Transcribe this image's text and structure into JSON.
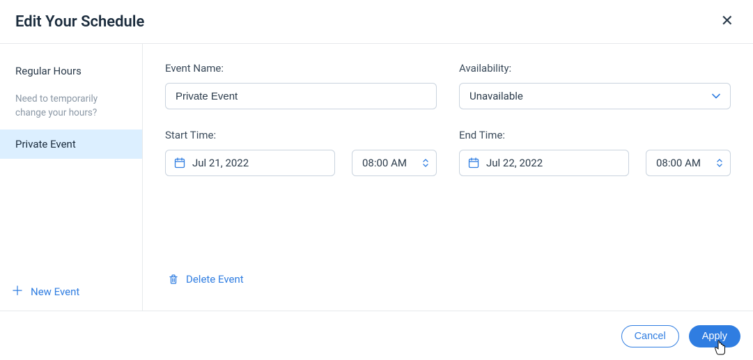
{
  "header": {
    "title": "Edit Your Schedule"
  },
  "sidebar": {
    "regular_hours": "Regular Hours",
    "help_text": "Need to temporarily change your hours?",
    "selected_event": "Private Event",
    "new_event": "New Event"
  },
  "form": {
    "event_name_label": "Event Name:",
    "event_name_value": "Private Event",
    "availability_label": "Availability:",
    "availability_value": "Unavailable",
    "start_label": "Start Time:",
    "start_date": "Jul 21, 2022",
    "start_time": "08:00 AM",
    "end_label": "End Time:",
    "end_date": "Jul 22, 2022",
    "end_time": "08:00 AM",
    "delete_label": "Delete Event"
  },
  "footer": {
    "cancel": "Cancel",
    "apply": "Apply"
  }
}
